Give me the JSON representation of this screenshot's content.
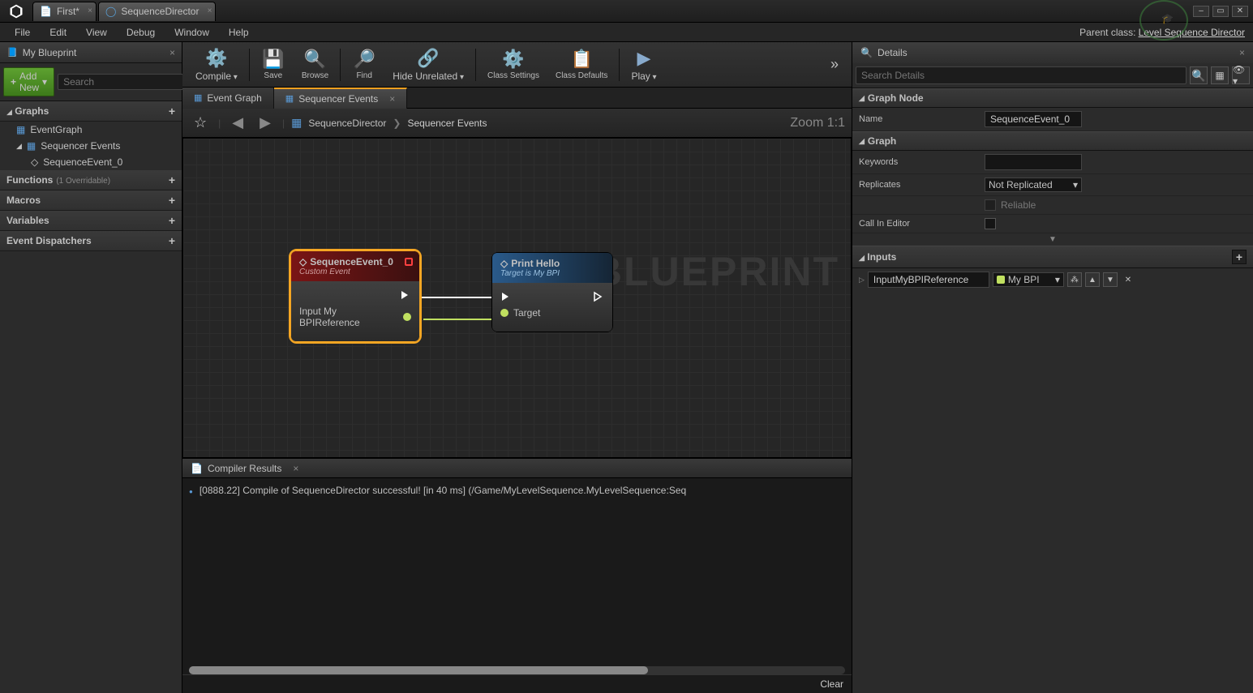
{
  "tabs": {
    "first": "First*",
    "second": "SequenceDirector"
  },
  "menu": {
    "file": "File",
    "edit": "Edit",
    "view": "View",
    "debug": "Debug",
    "window": "Window",
    "help": "Help"
  },
  "parent": {
    "label": "Parent class:",
    "link": "Level Sequence Director"
  },
  "mybp": {
    "title": "My Blueprint",
    "addnew": "Add New",
    "search": "Search",
    "graphs": "Graphs",
    "eventgraph": "EventGraph",
    "seqevents": "Sequencer Events",
    "seqevent0": "SequenceEvent_0",
    "functions": "Functions",
    "functions_sub": "(1 Overridable)",
    "macros": "Macros",
    "variables": "Variables",
    "dispatchers": "Event Dispatchers"
  },
  "toolbar": {
    "compile": "Compile",
    "save": "Save",
    "browse": "Browse",
    "find": "Find",
    "hide": "Hide Unrelated",
    "cls": "Class Settings",
    "cld": "Class Defaults",
    "play": "Play"
  },
  "gtabs": {
    "eg": "Event Graph",
    "se": "Sequencer Events"
  },
  "nav": {
    "bc1": "SequenceDirector",
    "bc2": "Sequencer Events",
    "zoom": "Zoom 1:1"
  },
  "nodes": {
    "seq": {
      "title": "SequenceEvent_0",
      "sub": "Custom Event",
      "out": "Input My BPIReference"
    },
    "print": {
      "title": "Print Hello",
      "sub": "Target is My BPI",
      "in": "Target"
    }
  },
  "watermark": "BLUEPRINT",
  "compiler": {
    "title": "Compiler Results",
    "msg": "[0888.22] Compile of SequenceDirector successful! [in 40 ms] (/Game/MyLevelSequence.MyLevelSequence:Seq",
    "clear": "Clear"
  },
  "details": {
    "title": "Details",
    "search": "Search Details",
    "graphnode": "Graph Node",
    "name": "Name",
    "nameval": "SequenceEvent_0",
    "graph": "Graph",
    "keywords": "Keywords",
    "replicates": "Replicates",
    "repval": "Not Replicated",
    "reliable": "Reliable",
    "callin": "Call In Editor",
    "inputs": "Inputs",
    "param": "InputMyBPIReference",
    "ptype": "My BPI"
  }
}
